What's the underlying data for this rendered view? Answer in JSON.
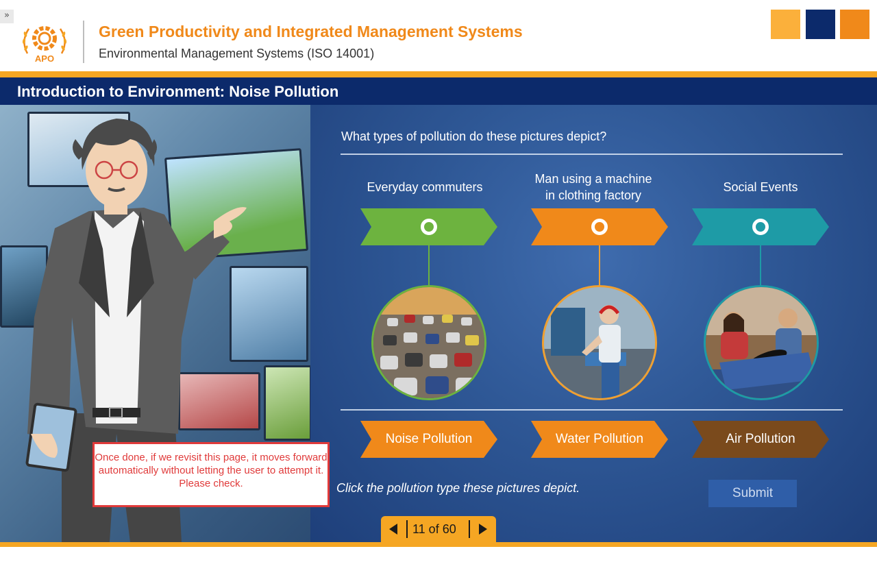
{
  "header": {
    "expand_glyph": "»",
    "logo_text": "APO",
    "title": "Green Productivity and Integrated Management Systems",
    "subtitle": "Environmental Management Systems (ISO 14001)",
    "accent_colors": [
      "#fbb03b",
      "#0c2a6b",
      "#f0891a"
    ]
  },
  "slide": {
    "title": "Introduction to Environment: Noise Pollution"
  },
  "activity": {
    "question": "What types of pollution do these pictures depict?",
    "categories": [
      {
        "label_line1": "Everyday commuters",
        "label_line2": "",
        "color": "#6db33f",
        "picture": "traffic-photo"
      },
      {
        "label_line1": "Man using a machine",
        "label_line2": "in clothing factory",
        "color": "#f0891a",
        "picture": "factory-photo"
      },
      {
        "label_line1": "Social Events",
        "label_line2": "",
        "color": "#1e9ba6",
        "picture": "party-photo"
      }
    ],
    "options": [
      {
        "label": "Noise Pollution",
        "color": "#f0891a"
      },
      {
        "label": "Water Pollution",
        "color": "#f0891a"
      },
      {
        "label": "Air Pollution",
        "color": "#7a4a1c"
      }
    ],
    "instruction": "Click the pollution type these pictures depict.",
    "submit_label": "Submit"
  },
  "pager": {
    "text": "11 of 60"
  },
  "review_note": {
    "text": "Once done, if we revisit this page, it moves forward automatically without letting the user to attempt it. Please check."
  },
  "footer": {
    "color": "#f5a623"
  }
}
